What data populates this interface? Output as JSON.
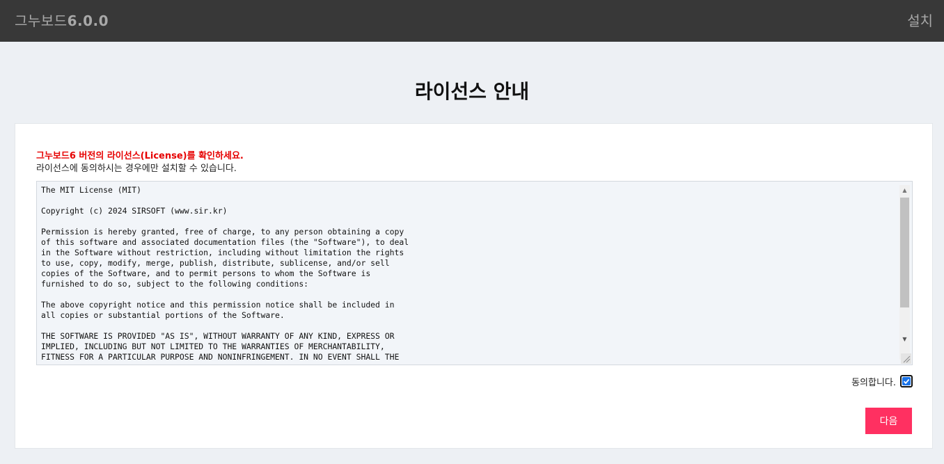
{
  "header": {
    "brand_name": "그누보드",
    "brand_version": "6.0.0",
    "right_label": "설치"
  },
  "page": {
    "title": "라이선스 안내"
  },
  "notice": {
    "headline": "그누보드6 버전의 라이선스(License)를 확인하세요.",
    "sub": "라이선스에 동의하시는 경우에만 설치할 수 있습니다."
  },
  "license": {
    "text": "The MIT License (MIT)\n\nCopyright (c) 2024 SIRSOFT (www.sir.kr)\n\nPermission is hereby granted, free of charge, to any person obtaining a copy\nof this software and associated documentation files (the \"Software\"), to deal\nin the Software without restriction, including without limitation the rights\nto use, copy, modify, merge, publish, distribute, sublicense, and/or sell\ncopies of the Software, and to permit persons to whom the Software is\nfurnished to do so, subject to the following conditions:\n\nThe above copyright notice and this permission notice shall be included in\nall copies or substantial portions of the Software.\n\nTHE SOFTWARE IS PROVIDED \"AS IS\", WITHOUT WARRANTY OF ANY KIND, EXPRESS OR\nIMPLIED, INCLUDING BUT NOT LIMITED TO THE WARRANTIES OF MERCHANTABILITY,\nFITNESS FOR A PARTICULAR PURPOSE AND NONINFRINGEMENT. IN NO EVENT SHALL THE"
  },
  "agree": {
    "label": "동의합니다.",
    "checked": true
  },
  "actions": {
    "next_label": "다음"
  },
  "colors": {
    "header_bg": "#383838",
    "accent_button": "#ff3061",
    "notice_red": "#e60000",
    "checkbox_blue": "#1a73e8"
  }
}
